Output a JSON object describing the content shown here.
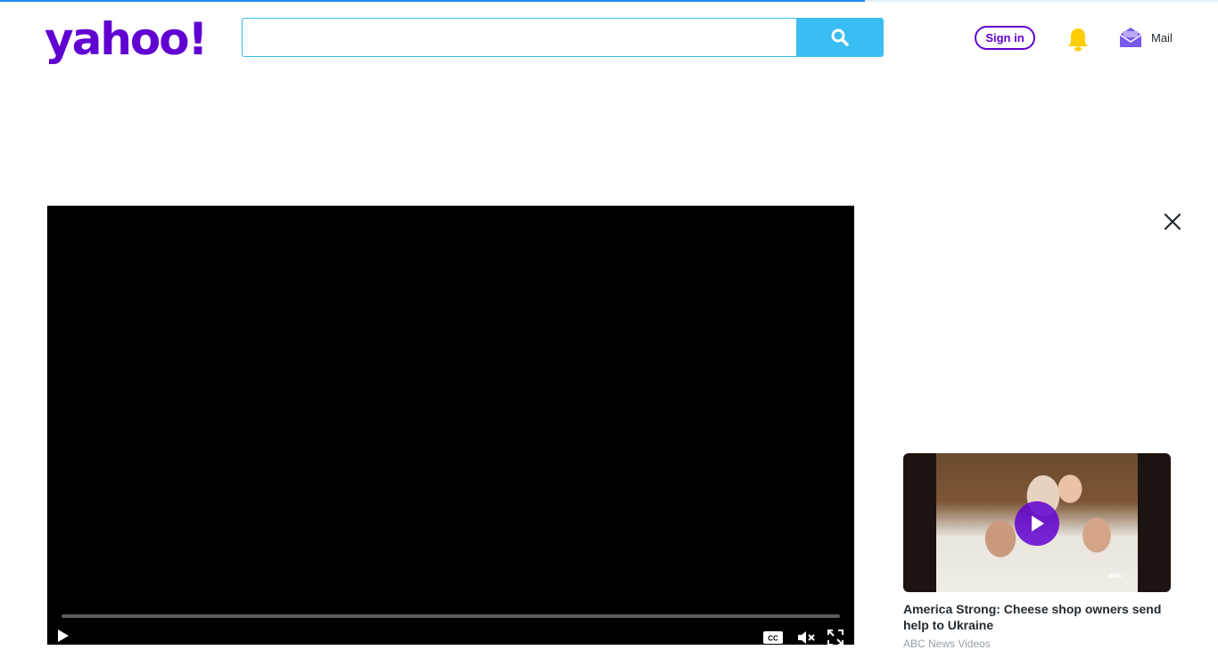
{
  "header": {
    "logo_text": "yahoo!",
    "search": {
      "value": "",
      "placeholder": ""
    },
    "signin_label": "Sign in",
    "mail_label": "Mail"
  },
  "video_player": {
    "progress": 0,
    "controls": [
      "play-icon",
      "closed-captions-icon",
      "mute-icon",
      "fullscreen-icon"
    ],
    "cc_label": "CC"
  },
  "related": {
    "title": "America Strong: Cheese shop owners send help to Ukraine",
    "source": "ABC News Videos",
    "thumb_badge": "abc"
  },
  "colors": {
    "brand": "#6001d2",
    "search_accent": "#39bdf2",
    "bell": "#ffcd00",
    "mail_icon": "#7759f0"
  }
}
